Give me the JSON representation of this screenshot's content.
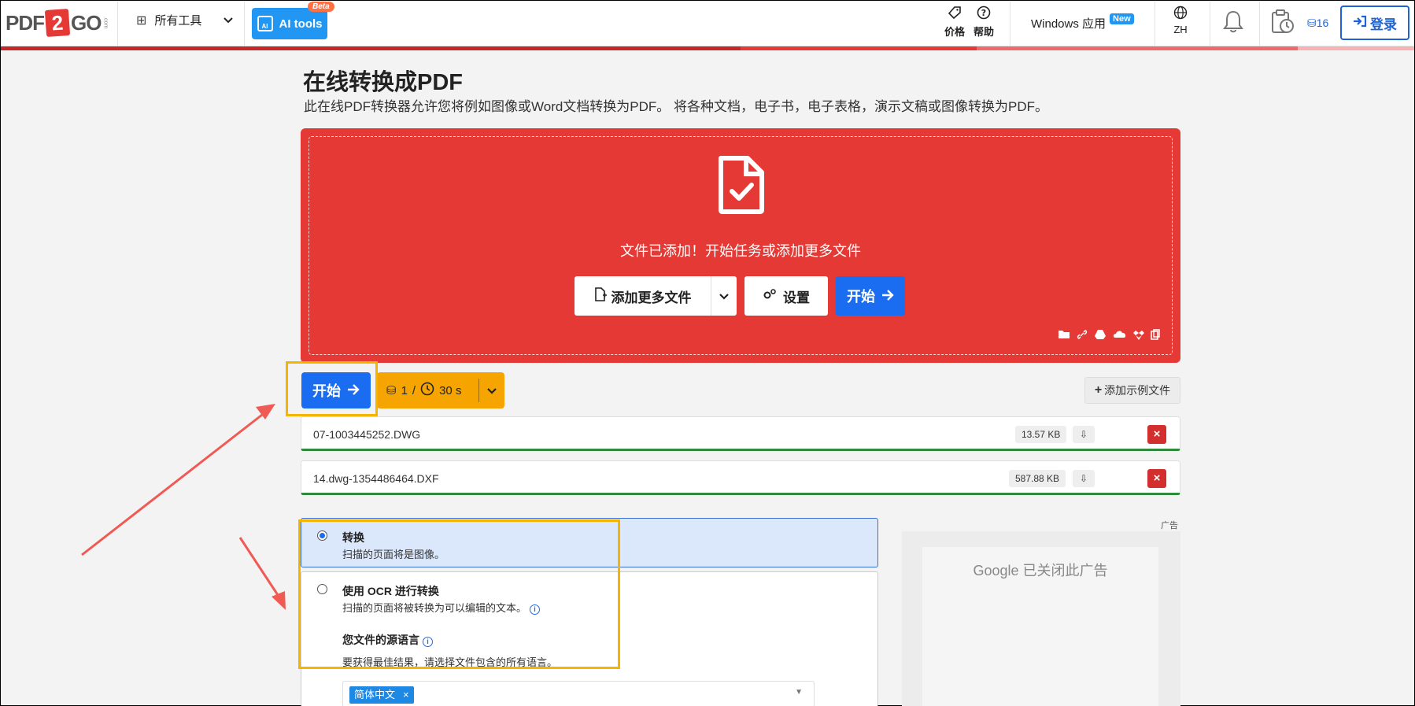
{
  "header": {
    "logo_left": "PDF",
    "logo_two": "2",
    "logo_right": "GO",
    "logo_small": ".com",
    "all_tools": "所有工具",
    "ai_tools": "AI tools",
    "ai_beta": "Beta",
    "ai_icon_label": "AI",
    "price": "价格",
    "help": "帮助",
    "windows_app": "Windows 应用",
    "new_badge": "New",
    "language": "ZH",
    "credits": "16",
    "login": "登录"
  },
  "page": {
    "title": "在线转换成PDF",
    "description": "此在线PDF转换器允许您将例如图像或Word文档转换为PDF。 将各种文档，电子书，电子表格，演示文稿或图像转换为PDF。"
  },
  "upload": {
    "message": "文件已添加！开始任务或添加更多文件",
    "add_more": "添加更多文件",
    "settings": "设置",
    "start": "开始"
  },
  "actions": {
    "start": "开始",
    "cost_count": "1",
    "cost_sep": "/",
    "cost_time": "30 s",
    "add_sample": "添加示例文件"
  },
  "files": [
    {
      "name": "07-1003445252.DWG",
      "size": "13.57 KB"
    },
    {
      "name": "14.dwg-1354486464.DXF",
      "size": "587.88 KB"
    }
  ],
  "options": {
    "convert_title": "转换",
    "convert_desc": "扫描的页面将是图像。",
    "ocr_title": "使用 OCR 进行转换",
    "ocr_desc": "扫描的页面将被转换为可以编辑的文本。",
    "lang_title": "您文件的源语言",
    "lang_desc": "要获得最佳结果，请选择文件包含的所有语言。",
    "lang_selected": "简体中文",
    "lang_remove": "×"
  },
  "ad": {
    "label": "广告",
    "closed_text": "Google 已关闭此广告"
  },
  "colors": {
    "brand_red": "#e53935",
    "primary_blue": "#1a6cf0",
    "credit_orange": "#f5a400",
    "highlight_yellow": "#f5b400",
    "arrow_red": "#f05a55"
  }
}
